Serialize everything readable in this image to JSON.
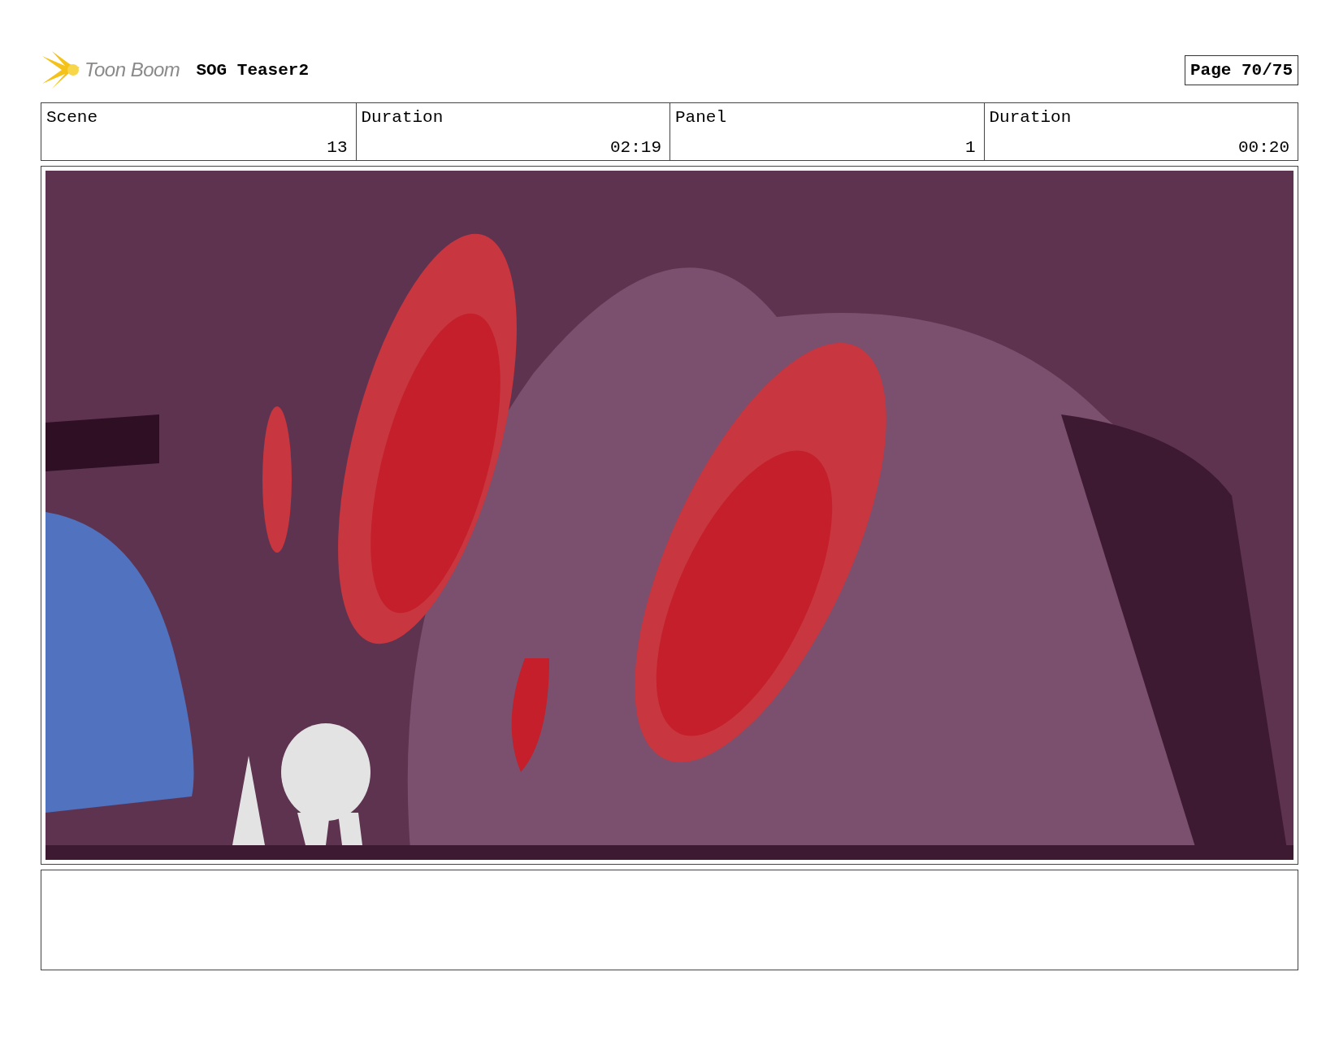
{
  "header": {
    "logo": "Toon Boom",
    "title": "SOG Teaser2",
    "page": "Page 70/75"
  },
  "info": {
    "labels": [
      "Scene",
      "Duration",
      "Panel",
      "Duration"
    ],
    "values": [
      "13",
      "02:19",
      "1",
      "00:20"
    ]
  }
}
